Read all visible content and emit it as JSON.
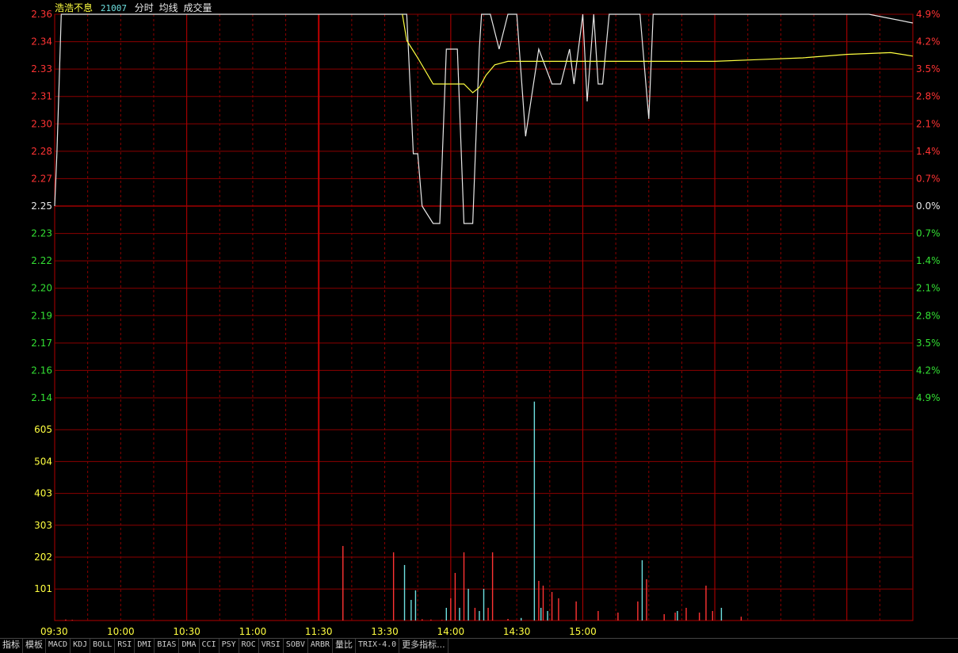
{
  "header": {
    "stock_name": "浩浩不息",
    "stock_code": "21007",
    "items": [
      "分时",
      "均线",
      "成交量"
    ]
  },
  "colors": {
    "up": "#ff3333",
    "down": "#33e033",
    "neutral": "#e8e8e8",
    "grid": "#8b0000",
    "price_line": "#e8e8e8",
    "avg_line": "#ffff40",
    "volume_up": "#ff3333",
    "volume_other": "#6ee0e0",
    "volume_axis": "#ffff40"
  },
  "tabs": [
    "指标",
    "模板",
    "MACD",
    "KDJ",
    "BOLL",
    "RSI",
    "DMI",
    "BIAS",
    "DMA",
    "CCI",
    "PSY",
    "ROC",
    "VRSI",
    "SOBV",
    "ARBR",
    "量比",
    "TRIX-4.0",
    "更多指标..."
  ],
  "chart_data": [
    {
      "type": "line",
      "title": "分时",
      "x_labels": [
        "09:30",
        "10:00",
        "10:30",
        "11:00",
        "11:30",
        "13:30",
        "14:00",
        "14:30",
        "15:00"
      ],
      "left_ticks": [
        "2.36",
        "2.34",
        "2.33",
        "2.31",
        "2.30",
        "2.28",
        "2.27",
        "2.25",
        "2.23",
        "2.22",
        "2.20",
        "2.19",
        "2.17",
        "2.16",
        "2.14"
      ],
      "right_ticks": [
        "4.9%",
        "4.2%",
        "3.5%",
        "2.8%",
        "2.1%",
        "1.4%",
        "0.7%",
        "0.0%",
        "0.7%",
        "1.4%",
        "2.1%",
        "2.8%",
        "3.5%",
        "4.2%",
        "4.9%"
      ],
      "ylim": [
        2.14,
        2.36
      ],
      "reference_price": 2.25,
      "series": [
        {
          "name": "分时",
          "minutes": [
            0,
            1,
            2,
            3,
            4,
            5,
            6,
            7,
            158,
            160,
            163,
            165,
            167,
            172,
            175,
            178,
            183,
            186,
            190,
            193,
            194,
            198,
            202,
            206,
            210,
            214,
            220,
            226,
            230,
            234,
            236,
            240,
            242,
            245,
            247,
            249,
            252,
            256,
            260,
            266,
            270,
            272,
            275,
            280,
            282,
            286,
            292,
            300,
            310,
            330,
            350,
            370,
            390
          ],
          "values": [
            2.25,
            2.28,
            2.32,
            2.36,
            2.36,
            2.36,
            2.36,
            2.36,
            2.36,
            2.36,
            2.28,
            2.28,
            2.25,
            2.24,
            2.24,
            2.34,
            2.34,
            2.24,
            2.24,
            2.34,
            2.36,
            2.36,
            2.34,
            2.36,
            2.36,
            2.29,
            2.34,
            2.32,
            2.32,
            2.34,
            2.32,
            2.36,
            2.31,
            2.36,
            2.32,
            2.32,
            2.36,
            2.36,
            2.36,
            2.36,
            2.3,
            2.36,
            2.36,
            2.36,
            2.36,
            2.36,
            2.36,
            2.36,
            2.36,
            2.36,
            2.36,
            2.36,
            2.355
          ]
        },
        {
          "name": "均线",
          "minutes": [
            158,
            160,
            165,
            172,
            180,
            186,
            190,
            193,
            196,
            200,
            206,
            212,
            240,
            260,
            280,
            300,
            320,
            340,
            360,
            380,
            390
          ],
          "values": [
            2.36,
            2.345,
            2.335,
            2.32,
            2.32,
            2.32,
            2.315,
            2.318,
            2.325,
            2.331,
            2.333,
            2.333,
            2.333,
            2.333,
            2.333,
            2.333,
            2.334,
            2.335,
            2.337,
            2.338,
            2.336
          ]
        }
      ]
    },
    {
      "type": "bar",
      "title": "成交量",
      "left_ticks": [
        "605",
        "504",
        "403",
        "303",
        "202",
        "101"
      ],
      "ylim": [
        0,
        702
      ],
      "bars": [
        {
          "minute": 5,
          "value": 3,
          "dir": "up"
        },
        {
          "minute": 8,
          "value": 2,
          "dir": "up"
        },
        {
          "minute": 131,
          "value": 235,
          "dir": "up"
        },
        {
          "minute": 154,
          "value": 215,
          "dir": "up"
        },
        {
          "minute": 159,
          "value": 175,
          "dir": "other"
        },
        {
          "minute": 162,
          "value": 65,
          "dir": "other"
        },
        {
          "minute": 164,
          "value": 95,
          "dir": "other"
        },
        {
          "minute": 167,
          "value": 4,
          "dir": "up"
        },
        {
          "minute": 171,
          "value": 3,
          "dir": "up"
        },
        {
          "minute": 176,
          "value": 2,
          "dir": "up"
        },
        {
          "minute": 178,
          "value": 40,
          "dir": "other"
        },
        {
          "minute": 180,
          "value": 70,
          "dir": "up"
        },
        {
          "minute": 182,
          "value": 150,
          "dir": "up"
        },
        {
          "minute": 184,
          "value": 40,
          "dir": "other"
        },
        {
          "minute": 186,
          "value": 215,
          "dir": "up"
        },
        {
          "minute": 188,
          "value": 100,
          "dir": "other"
        },
        {
          "minute": 191,
          "value": 40,
          "dir": "up"
        },
        {
          "minute": 193,
          "value": 30,
          "dir": "other"
        },
        {
          "minute": 195,
          "value": 100,
          "dir": "other"
        },
        {
          "minute": 197,
          "value": 40,
          "dir": "up"
        },
        {
          "minute": 199,
          "value": 215,
          "dir": "up"
        },
        {
          "minute": 206,
          "value": 5,
          "dir": "up"
        },
        {
          "minute": 212,
          "value": 8,
          "dir": "other"
        },
        {
          "minute": 218,
          "value": 690,
          "dir": "other"
        },
        {
          "minute": 220,
          "value": 125,
          "dir": "up"
        },
        {
          "minute": 221,
          "value": 40,
          "dir": "other"
        },
        {
          "minute": 222,
          "value": 110,
          "dir": "up"
        },
        {
          "minute": 224,
          "value": 30,
          "dir": "other"
        },
        {
          "minute": 226,
          "value": 90,
          "dir": "up"
        },
        {
          "minute": 229,
          "value": 70,
          "dir": "up"
        },
        {
          "minute": 237,
          "value": 60,
          "dir": "up"
        },
        {
          "minute": 247,
          "value": 30,
          "dir": "up"
        },
        {
          "minute": 256,
          "value": 25,
          "dir": "up"
        },
        {
          "minute": 265,
          "value": 60,
          "dir": "up"
        },
        {
          "minute": 267,
          "value": 190,
          "dir": "other"
        },
        {
          "minute": 269,
          "value": 130,
          "dir": "up"
        },
        {
          "minute": 277,
          "value": 20,
          "dir": "up"
        },
        {
          "minute": 282,
          "value": 25,
          "dir": "up"
        },
        {
          "minute": 283,
          "value": 30,
          "dir": "other"
        },
        {
          "minute": 287,
          "value": 40,
          "dir": "up"
        },
        {
          "minute": 293,
          "value": 25,
          "dir": "up"
        },
        {
          "minute": 296,
          "value": 110,
          "dir": "up"
        },
        {
          "minute": 299,
          "value": 30,
          "dir": "up"
        },
        {
          "minute": 303,
          "value": 40,
          "dir": "other"
        },
        {
          "minute": 312,
          "value": 12,
          "dir": "up"
        }
      ]
    }
  ]
}
